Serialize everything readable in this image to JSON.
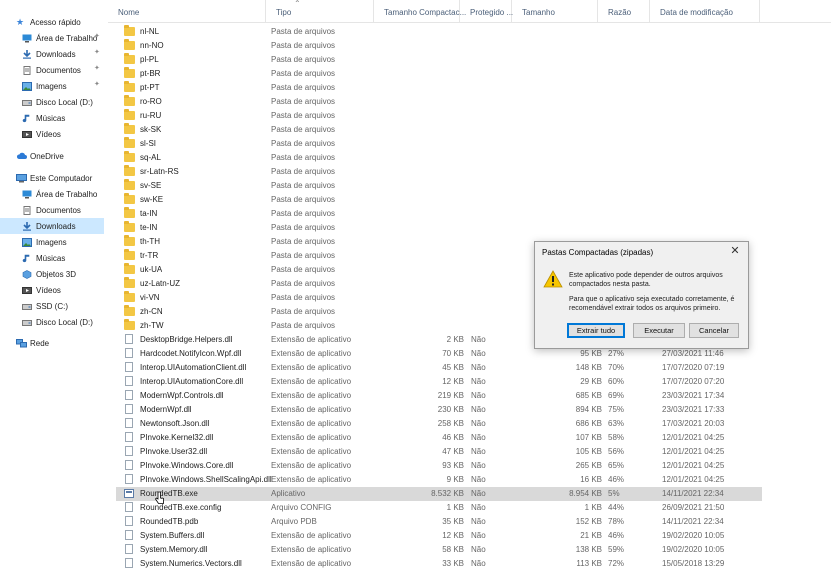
{
  "sidebar": {
    "quick_access": {
      "label": "Acesso rápido"
    },
    "quick_items": [
      {
        "label": "Área de Trabalho",
        "icon": "desktop-icon",
        "pinned": true
      },
      {
        "label": "Downloads",
        "icon": "download-icon",
        "pinned": true
      },
      {
        "label": "Documentos",
        "icon": "documents-icon",
        "pinned": true
      },
      {
        "label": "Imagens",
        "icon": "pictures-icon",
        "pinned": true
      },
      {
        "label": "Disco Local (D:)",
        "icon": "drive-icon",
        "pinned": false
      },
      {
        "label": "Músicas",
        "icon": "music-icon",
        "pinned": false
      },
      {
        "label": "Vídeos",
        "icon": "videos-icon",
        "pinned": false
      }
    ],
    "onedrive": {
      "label": "OneDrive"
    },
    "this_pc": {
      "label": "Este Computador"
    },
    "pc_items": [
      {
        "label": "Área de Trabalho",
        "icon": "desktop-icon"
      },
      {
        "label": "Documentos",
        "icon": "documents-icon"
      },
      {
        "label": "Downloads",
        "icon": "download-icon",
        "selected": true
      },
      {
        "label": "Imagens",
        "icon": "pictures-icon"
      },
      {
        "label": "Músicas",
        "icon": "music-icon"
      },
      {
        "label": "Objetos 3D",
        "icon": "objects3d-icon"
      },
      {
        "label": "Vídeos",
        "icon": "videos-icon"
      },
      {
        "label": "SSD (C:)",
        "icon": "drive-icon"
      },
      {
        "label": "Disco Local (D:)",
        "icon": "drive-icon"
      }
    ],
    "network": {
      "label": "Rede"
    }
  },
  "columns": {
    "name": "Nome",
    "type": "Tipo",
    "compressed": "Tamanho Compactac...",
    "protected": "Protegido ...",
    "size": "Tamanho",
    "ratio": "Razão",
    "date": "Data de modificação"
  },
  "files": [
    {
      "name": "nl-NL",
      "type": "Pasta de arquivos",
      "kind": "folder"
    },
    {
      "name": "nn-NO",
      "type": "Pasta de arquivos",
      "kind": "folder"
    },
    {
      "name": "pl-PL",
      "type": "Pasta de arquivos",
      "kind": "folder"
    },
    {
      "name": "pt-BR",
      "type": "Pasta de arquivos",
      "kind": "folder"
    },
    {
      "name": "pt-PT",
      "type": "Pasta de arquivos",
      "kind": "folder"
    },
    {
      "name": "ro-RO",
      "type": "Pasta de arquivos",
      "kind": "folder"
    },
    {
      "name": "ru-RU",
      "type": "Pasta de arquivos",
      "kind": "folder"
    },
    {
      "name": "sk-SK",
      "type": "Pasta de arquivos",
      "kind": "folder"
    },
    {
      "name": "sl-SI",
      "type": "Pasta de arquivos",
      "kind": "folder"
    },
    {
      "name": "sq-AL",
      "type": "Pasta de arquivos",
      "kind": "folder"
    },
    {
      "name": "sr-Latn-RS",
      "type": "Pasta de arquivos",
      "kind": "folder"
    },
    {
      "name": "sv-SE",
      "type": "Pasta de arquivos",
      "kind": "folder"
    },
    {
      "name": "sw-KE",
      "type": "Pasta de arquivos",
      "kind": "folder"
    },
    {
      "name": "ta-IN",
      "type": "Pasta de arquivos",
      "kind": "folder"
    },
    {
      "name": "te-IN",
      "type": "Pasta de arquivos",
      "kind": "folder"
    },
    {
      "name": "th-TH",
      "type": "Pasta de arquivos",
      "kind": "folder"
    },
    {
      "name": "tr-TR",
      "type": "Pasta de arquivos",
      "kind": "folder"
    },
    {
      "name": "uk-UA",
      "type": "Pasta de arquivos",
      "kind": "folder"
    },
    {
      "name": "uz-Latn-UZ",
      "type": "Pasta de arquivos",
      "kind": "folder"
    },
    {
      "name": "vi-VN",
      "type": "Pasta de arquivos",
      "kind": "folder"
    },
    {
      "name": "zh-CN",
      "type": "Pasta de arquivos",
      "kind": "folder"
    },
    {
      "name": "zh-TW",
      "type": "Pasta de arquivos",
      "kind": "folder"
    },
    {
      "name": "DesktopBridge.Helpers.dll",
      "type": "Extensão de aplicativo",
      "compressed": "2 KB",
      "protected": "Não",
      "size": "",
      "ratio": "",
      "date": "",
      "kind": "file"
    },
    {
      "name": "Hardcodet.NotifyIcon.Wpf.dll",
      "type": "Extensão de aplicativo",
      "compressed": "70 KB",
      "protected": "Não",
      "size": "95 KB",
      "ratio": "27%",
      "date": "27/03/2021 11:46",
      "kind": "file"
    },
    {
      "name": "Interop.UIAutomationClient.dll",
      "type": "Extensão de aplicativo",
      "compressed": "45 KB",
      "protected": "Não",
      "size": "148 KB",
      "ratio": "70%",
      "date": "17/07/2020 07:19",
      "kind": "file"
    },
    {
      "name": "Interop.UIAutomationCore.dll",
      "type": "Extensão de aplicativo",
      "compressed": "12 KB",
      "protected": "Não",
      "size": "29 KB",
      "ratio": "60%",
      "date": "17/07/2020 07:20",
      "kind": "file"
    },
    {
      "name": "ModernWpf.Controls.dll",
      "type": "Extensão de aplicativo",
      "compressed": "219 KB",
      "protected": "Não",
      "size": "685 KB",
      "ratio": "69%",
      "date": "23/03/2021 17:34",
      "kind": "file"
    },
    {
      "name": "ModernWpf.dll",
      "type": "Extensão de aplicativo",
      "compressed": "230 KB",
      "protected": "Não",
      "size": "894 KB",
      "ratio": "75%",
      "date": "23/03/2021 17:33",
      "kind": "file"
    },
    {
      "name": "Newtonsoft.Json.dll",
      "type": "Extensão de aplicativo",
      "compressed": "258 KB",
      "protected": "Não",
      "size": "686 KB",
      "ratio": "63%",
      "date": "17/03/2021 20:03",
      "kind": "file"
    },
    {
      "name": "PInvoke.Kernel32.dll",
      "type": "Extensão de aplicativo",
      "compressed": "46 KB",
      "protected": "Não",
      "size": "107 KB",
      "ratio": "58%",
      "date": "12/01/2021 04:25",
      "kind": "file"
    },
    {
      "name": "PInvoke.User32.dll",
      "type": "Extensão de aplicativo",
      "compressed": "47 KB",
      "protected": "Não",
      "size": "105 KB",
      "ratio": "56%",
      "date": "12/01/2021 04:25",
      "kind": "file"
    },
    {
      "name": "PInvoke.Windows.Core.dll",
      "type": "Extensão de aplicativo",
      "compressed": "93 KB",
      "protected": "Não",
      "size": "265 KB",
      "ratio": "65%",
      "date": "12/01/2021 04:25",
      "kind": "file"
    },
    {
      "name": "PInvoke.Windows.ShellScalingApi.dll",
      "type": "Extensão de aplicativo",
      "compressed": "9 KB",
      "protected": "Não",
      "size": "16 KB",
      "ratio": "46%",
      "date": "12/01/2021 04:25",
      "kind": "file"
    },
    {
      "name": "RoundedTB.exe",
      "type": "Aplicativo",
      "compressed": "8.532 KB",
      "protected": "Não",
      "size": "8.954 KB",
      "ratio": "5%",
      "date": "14/11/2021 22:34",
      "kind": "exe",
      "highlighted": true
    },
    {
      "name": "RoundedTB.exe.config",
      "type": "Arquivo CONFIG",
      "compressed": "1 KB",
      "protected": "Não",
      "size": "1 KB",
      "ratio": "44%",
      "date": "26/09/2021 21:50",
      "kind": "file"
    },
    {
      "name": "RoundedTB.pdb",
      "type": "Arquivo PDB",
      "compressed": "35 KB",
      "protected": "Não",
      "size": "152 KB",
      "ratio": "78%",
      "date": "14/11/2021 22:34",
      "kind": "file"
    },
    {
      "name": "System.Buffers.dll",
      "type": "Extensão de aplicativo",
      "compressed": "12 KB",
      "protected": "Não",
      "size": "21 KB",
      "ratio": "46%",
      "date": "19/02/2020 10:05",
      "kind": "file"
    },
    {
      "name": "System.Memory.dll",
      "type": "Extensão de aplicativo",
      "compressed": "58 KB",
      "protected": "Não",
      "size": "138 KB",
      "ratio": "59%",
      "date": "19/02/2020 10:05",
      "kind": "file"
    },
    {
      "name": "System.Numerics.Vectors.dll",
      "type": "Extensão de aplicativo",
      "compressed": "33 KB",
      "protected": "Não",
      "size": "113 KB",
      "ratio": "72%",
      "date": "15/05/2018 13:29",
      "kind": "file"
    }
  ],
  "dialog": {
    "title": "Pastas Compactadas (zipadas)",
    "close_label": "✕",
    "message1": "Este aplicativo pode depender de outros arquivos compactados nesta pasta.",
    "message2": "Para que o aplicativo seja executado corretamente, é recomendável extrair todos os arquivos primeiro.",
    "buttons": {
      "extract": "Extrair tudo",
      "run": "Executar",
      "cancel": "Cancelar"
    }
  },
  "colors": {
    "selection": "#cce8ff",
    "highlight_row": "#d9d9d9",
    "folder": "#f3c744",
    "accent": "#0078d7",
    "warning": "#f7c600"
  }
}
